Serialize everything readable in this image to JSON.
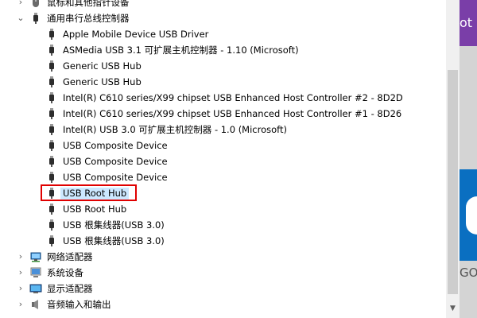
{
  "tree": {
    "rows": [
      {
        "label": "鼠标和其他指针设备",
        "twisty": "›",
        "icon": "mouse-icon",
        "level": 0
      },
      {
        "label": "通用串行总线控制器",
        "twisty": "⌄",
        "icon": "usb-controller-icon",
        "level": 0
      },
      {
        "label": "Apple Mobile Device USB Driver",
        "icon": "usb-plug-icon",
        "level": 1
      },
      {
        "label": "ASMedia USB 3.1 可扩展主机控制器 - 1.10 (Microsoft)",
        "icon": "usb-plug-icon",
        "level": 1
      },
      {
        "label": "Generic USB Hub",
        "icon": "usb-plug-icon",
        "level": 1
      },
      {
        "label": "Generic USB Hub",
        "icon": "usb-plug-icon",
        "level": 1
      },
      {
        "label": "Intel(R) C610 series/X99 chipset USB Enhanced Host Controller #2 - 8D2D",
        "icon": "usb-plug-icon",
        "level": 1
      },
      {
        "label": "Intel(R) C610 series/X99 chipset USB Enhanced Host Controller #1 - 8D26",
        "icon": "usb-plug-icon",
        "level": 1
      },
      {
        "label": "Intel(R) USB 3.0 可扩展主机控制器 - 1.0 (Microsoft)",
        "icon": "usb-plug-icon",
        "level": 1
      },
      {
        "label": "USB Composite Device",
        "icon": "usb-plug-icon",
        "level": 1
      },
      {
        "label": "USB Composite Device",
        "icon": "usb-plug-icon",
        "level": 1
      },
      {
        "label": "USB Composite Device",
        "icon": "usb-plug-icon",
        "level": 1
      },
      {
        "label": "USB Root Hub",
        "icon": "usb-plug-icon",
        "level": 1,
        "selected": true
      },
      {
        "label": "USB Root Hub",
        "icon": "usb-plug-icon",
        "level": 1
      },
      {
        "label": "USB 根集线器(USB 3.0)",
        "icon": "usb-plug-icon",
        "level": 1
      },
      {
        "label": "USB 根集线器(USB 3.0)",
        "icon": "usb-plug-icon",
        "level": 1
      },
      {
        "label": "网络适配器",
        "twisty": "›",
        "icon": "network-adapter-icon",
        "level": 0
      },
      {
        "label": "系统设备",
        "twisty": "›",
        "icon": "system-device-icon",
        "level": 0
      },
      {
        "label": "显示适配器",
        "twisty": "›",
        "icon": "display-adapter-icon",
        "level": 0
      },
      {
        "label": "音频输入和输出",
        "twisty": "›",
        "icon": "speaker-icon",
        "level": 0
      }
    ]
  },
  "scrollbar": {
    "down_arrow": "▼"
  },
  "background_window": {
    "top_text": "ot",
    "bottom_text": "GO"
  },
  "colors": {
    "selection": "#cce8ff",
    "highlight_border": "#e00000",
    "bg_purple": "#7a3ea8",
    "bg_blue": "#0a6fc1"
  }
}
